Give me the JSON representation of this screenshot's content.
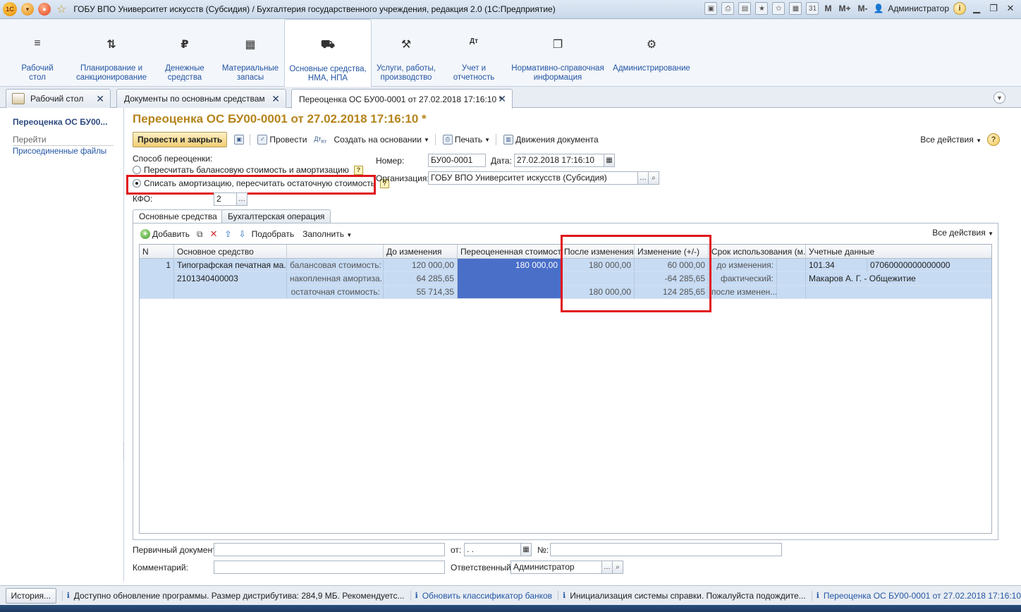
{
  "window": {
    "title": "ГОБУ ВПО Университет искусств (Субсидия) / Бухгалтерия государственного учреждения, редакция 2.0  (1С:Предприятие)",
    "user": "Администратор",
    "m_buttons": [
      "M",
      "M+",
      "M-"
    ]
  },
  "sections": [
    {
      "label": "Рабочий\nстол",
      "icon": "menu-icon",
      "glyph": "≡"
    },
    {
      "label": "Планирование и\nсанкционирование",
      "icon": "planning-icon",
      "glyph": "⇅"
    },
    {
      "label": "Денежные\nсредства",
      "icon": "ruble-icon",
      "glyph": "₽"
    },
    {
      "label": "Материальные\nзапасы",
      "icon": "grid-icon",
      "glyph": "▦"
    },
    {
      "label": "Основные средства,\nНМА, НПА",
      "icon": "truck-icon",
      "glyph": "⛟"
    },
    {
      "label": "Услуги, работы,\nпроизводство",
      "icon": "tools-icon",
      "glyph": "⚒"
    },
    {
      "label": "Учет и\nотчетность",
      "icon": "debit-credit-icon",
      "glyph": "Дт"
    },
    {
      "label": "Нормативно-справочная\nинформация",
      "icon": "documents-icon",
      "glyph": "❐"
    },
    {
      "label": "Администрирование",
      "icon": "gear-icon",
      "glyph": "⚙"
    }
  ],
  "open_tabs": [
    {
      "label": "Рабочий стол"
    },
    {
      "label": "Документы по основным средствам"
    },
    {
      "label": "Переоценка ОС БУ00-0001 от 27.02.2018 17:16:10 *"
    }
  ],
  "leftnav": {
    "title": "Переоценка ОС БУ00...",
    "goto": "Перейти",
    "link": "Присоединенные файлы"
  },
  "doc": {
    "title": "Переоценка ОС БУ00-0001 от 27.02.2018 17:16:10 *",
    "cmd": {
      "post_close": "Провести и закрыть",
      "post": "Провести",
      "create_based": "Создать на основании",
      "print": "Печать",
      "movements": "Движения документа",
      "all_actions": "Все действия"
    },
    "method_label": "Способ переоценки:",
    "method_options": [
      "Пересчитать балансовую стоимость и амортизацию",
      "Списать амортизацию, пересчитать остаточную стоимость"
    ],
    "number_label": "Номер:",
    "number": "БУ00-0001",
    "date_label": "Дата:",
    "date": "27.02.2018 17:16:10",
    "org_label": "Организация:",
    "org": "ГОБУ ВПО Университет искусств (Субсидия)",
    "kfo_label": "КФО:",
    "kfo": "2"
  },
  "inner_tabs": [
    "Основные средства",
    "Бухгалтерская операция"
  ],
  "table_bar": {
    "add": "Добавить",
    "pick": "Подобрать",
    "fill": "Заполнить",
    "all_actions": "Все действия"
  },
  "table": {
    "headers": [
      "N",
      "Основное средство",
      "",
      "До изменения",
      "Переоцененная стоимость",
      "После изменения",
      "Изменение (+/-)",
      "Срок использования (м...",
      "Учетные данные"
    ],
    "row": {
      "n": "1",
      "asset_name": "Типографская печатная ма...",
      "asset_code": "2101340400003",
      "kinds": [
        "балансовая стоимость:",
        "накопленная амортиза...",
        "остаточная стоимость:"
      ],
      "before": [
        "120 000,00",
        "64 285,65",
        "55 714,35"
      ],
      "revalued": "180 000,00",
      "after": [
        "180 000,00",
        "",
        "180 000,00"
      ],
      "change": [
        "60 000,00",
        "-64 285,65",
        "124 285,65"
      ],
      "term": [
        "до изменения:",
        "фактический:",
        "после изменен..."
      ],
      "account": "101.34",
      "kbk": "07060000000000000",
      "person": "Макаров А. Г. - Общежитие"
    }
  },
  "footer": {
    "primary_doc_label": "Первичный документ:",
    "from_label": "от:",
    "from_value": " .  .",
    "no_label": "№:",
    "comment_label": "Комментарий:",
    "responsible_label": "Ответственный:",
    "responsible": "Администратор"
  },
  "status": {
    "history": "История...",
    "messages": [
      "Доступно обновление программы. Размер дистрибутива: 284,9 МБ. Рекомендуетс...",
      "Обновить классификатор банков",
      "Инициализация системы справки. Пожалуйста подождите...",
      "Переоценка ОС БУ00-0001 от 27.02.2018 17:16:10"
    ]
  }
}
